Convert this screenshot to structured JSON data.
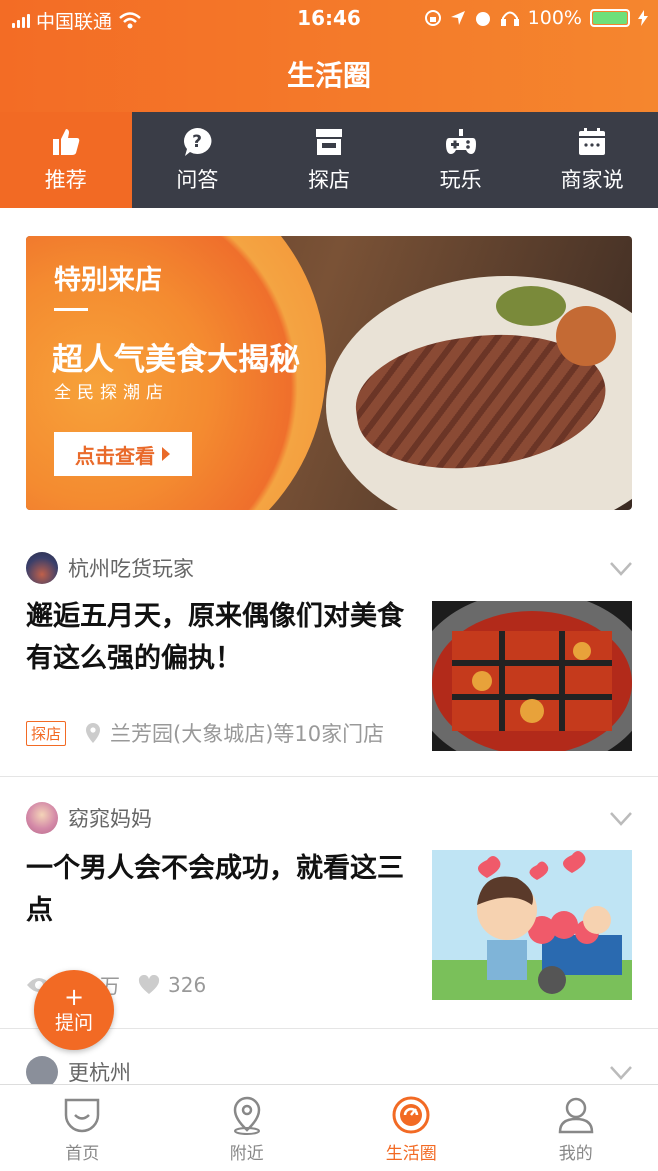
{
  "status_bar": {
    "carrier": "中国联通",
    "time": "16:46",
    "battery": "100%"
  },
  "header": {
    "title": "生活圈"
  },
  "tabs": [
    {
      "label": "推荐",
      "icon": "thumbs-up-icon",
      "active": true
    },
    {
      "label": "问答",
      "icon": "question-icon",
      "active": false
    },
    {
      "label": "探店",
      "icon": "store-icon",
      "active": false
    },
    {
      "label": "玩乐",
      "icon": "gamepad-icon",
      "active": false
    },
    {
      "label": "商家说",
      "icon": "calendar-icon",
      "active": false
    }
  ],
  "banner": {
    "tagline": "特别来店",
    "headline": "超人气美食大揭秘",
    "subline": "全民探潮店",
    "button": "点击查看"
  },
  "posts": [
    {
      "author": "杭州吃货玩家",
      "title": "邂逅五月天，原来偶像们对美食有这么强的偏执！",
      "tag": "探店",
      "location": "兰芳园(大象城店)等10家门店"
    },
    {
      "author": "窈窕妈妈",
      "title": "一个男人会不会成功，就看这三点",
      "views": "万",
      "likes": "326"
    },
    {
      "author": "更杭州"
    }
  ],
  "fab": {
    "plus": "+",
    "label": "提问"
  },
  "bottom_nav": [
    {
      "label": "首页",
      "icon": "home-face-icon",
      "active": false
    },
    {
      "label": "附近",
      "icon": "location-pin-icon",
      "active": false
    },
    {
      "label": "生活圈",
      "icon": "life-circle-icon",
      "active": true
    },
    {
      "label": "我的",
      "icon": "user-icon",
      "active": false
    }
  ],
  "colors": {
    "accent": "#f26a24",
    "tabbar": "#3a3d47"
  }
}
